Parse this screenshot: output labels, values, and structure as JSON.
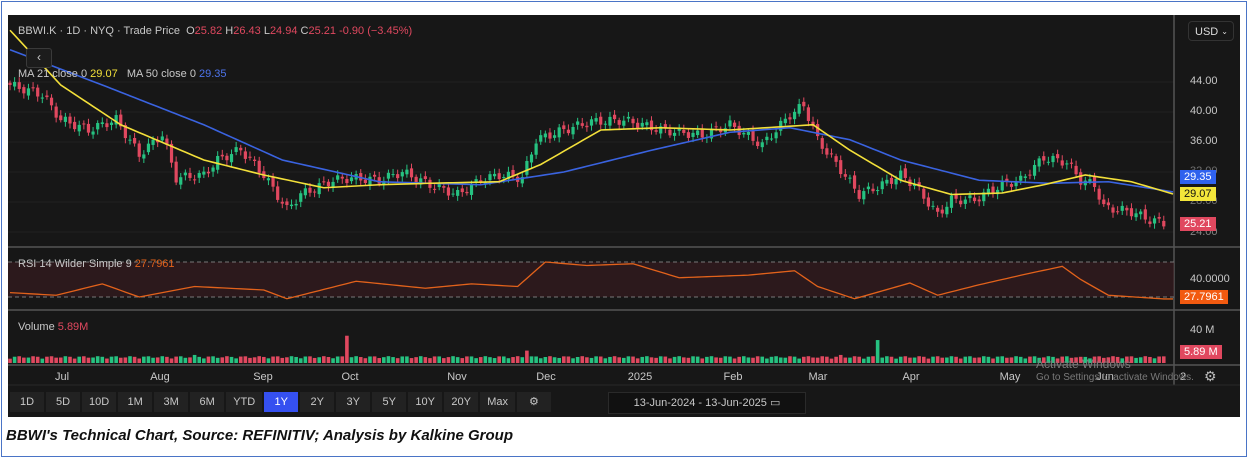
{
  "header": {
    "symbol": "BBWI.K · 1D · NYQ · Trade Price",
    "o_label": "O",
    "o": "25.82",
    "h_label": "H",
    "h": "26.43",
    "l_label": "L",
    "l": "24.94",
    "c_label": "C",
    "c": "25.21",
    "change": "-0.90 (−3.45%)",
    "collapse_icon": "‹"
  },
  "ma": {
    "ma21_label": "MA 21 close 0",
    "ma21": "29.07",
    "ma50_label": "MA 50 close 0",
    "ma50": "29.35"
  },
  "rsi": {
    "label": "RSI 14 Wilder Simple 9",
    "value": "27.7961",
    "level": "40.0000"
  },
  "volume": {
    "label": "Volume",
    "value": "5.89 M",
    "value_short": "5.89M",
    "tick": "40 M"
  },
  "currency": "USD",
  "price_ticks": [
    "44.00",
    "40.00",
    "36.00",
    "32.00",
    "28.00",
    "24.00"
  ],
  "x_labels": [
    "Jul",
    "Aug",
    "Sep",
    "Oct",
    "Nov",
    "Dec",
    "2025",
    "Feb",
    "Mar",
    "Apr",
    "May",
    "Jun",
    "2"
  ],
  "ranges": [
    "1D",
    "5D",
    "10D",
    "1M",
    "3M",
    "6M",
    "YTD",
    "1Y",
    "2Y",
    "3Y",
    "5Y",
    "10Y",
    "20Y",
    "Max"
  ],
  "active_range": "1Y",
  "date_range": "13-Jun-2024  -  13-Jun-2025",
  "watermark": {
    "title": "Activate Windows",
    "sub": "Go to Settings to activate Windows."
  },
  "caption": "BBWI's Technical Chart, Source: REFINITIV; Analysis by Kalkine Group",
  "colors": {
    "up": "#26c281",
    "down": "#e0485f",
    "ma21": "#f3e03a",
    "ma50": "#3a63e0",
    "rsi": "#e2621b",
    "active": "#3550f0"
  },
  "chart_data": {
    "type": "line",
    "title": "BBWI.K 1D Trade Price",
    "days_total": 252,
    "close": [
      [
        0,
        43.6
      ],
      [
        7,
        42.3
      ],
      [
        11,
        39
      ],
      [
        17,
        37.6
      ],
      [
        23,
        39
      ],
      [
        28,
        34.3
      ],
      [
        33,
        37
      ],
      [
        36,
        31.2
      ],
      [
        42,
        31.6
      ],
      [
        45,
        33.6
      ],
      [
        50,
        35
      ],
      [
        55,
        31.6
      ],
      [
        60,
        27
      ],
      [
        63,
        29
      ],
      [
        70,
        30.9
      ],
      [
        74,
        31.2
      ],
      [
        80,
        30.9
      ],
      [
        85,
        32
      ],
      [
        91,
        30.3
      ],
      [
        97,
        29
      ],
      [
        102,
        30.9
      ],
      [
        106,
        31.6
      ],
      [
        111,
        31.2
      ],
      [
        114,
        36.3
      ],
      [
        120,
        37.6
      ],
      [
        126,
        38.7
      ],
      [
        133,
        38.9
      ],
      [
        137,
        38.3
      ],
      [
        141,
        37.6
      ],
      [
        150,
        36.9
      ],
      [
        156,
        38.3
      ],
      [
        163,
        35.6
      ],
      [
        169,
        39.6
      ],
      [
        172,
        40.9
      ],
      [
        175,
        36.3
      ],
      [
        180,
        32.3
      ],
      [
        184,
        29
      ],
      [
        189,
        30.3
      ],
      [
        193,
        31.6
      ],
      [
        196,
        30.3
      ],
      [
        201,
        26.3
      ],
      [
        204,
        28.3
      ],
      [
        209,
        28.3
      ],
      [
        215,
        30.3
      ],
      [
        219,
        30.9
      ],
      [
        224,
        33.9
      ],
      [
        229,
        33.3
      ],
      [
        232,
        30.9
      ],
      [
        235,
        30.3
      ],
      [
        237,
        27.3
      ],
      [
        243,
        26.7
      ],
      [
        247,
        25.6
      ],
      [
        250,
        25.21
      ]
    ],
    "ma21": [
      [
        0,
        50.9
      ],
      [
        11,
        43.6
      ],
      [
        24,
        38.3
      ],
      [
        42,
        33.6
      ],
      [
        55,
        31.6
      ],
      [
        68,
        29.9
      ],
      [
        80,
        30.3
      ],
      [
        91,
        30.5
      ],
      [
        106,
        30.7
      ],
      [
        115,
        33
      ],
      [
        128,
        37.6
      ],
      [
        141,
        37.9
      ],
      [
        156,
        37.6
      ],
      [
        174,
        38.3
      ],
      [
        182,
        34.9
      ],
      [
        193,
        30.9
      ],
      [
        204,
        29
      ],
      [
        215,
        29.2
      ],
      [
        224,
        30.3
      ],
      [
        233,
        31.6
      ],
      [
        243,
        30.7
      ],
      [
        252,
        29.07
      ]
    ],
    "ma50": [
      [
        0,
        48.3
      ],
      [
        20,
        43.6
      ],
      [
        42,
        38.3
      ],
      [
        59,
        33.6
      ],
      [
        80,
        30.7
      ],
      [
        102,
        30.3
      ],
      [
        120,
        32
      ],
      [
        139,
        34.9
      ],
      [
        156,
        37.3
      ],
      [
        169,
        37.9
      ],
      [
        182,
        36.3
      ],
      [
        193,
        33.6
      ],
      [
        210,
        30.9
      ],
      [
        225,
        30.5
      ],
      [
        238,
        30.7
      ],
      [
        252,
        29.35
      ]
    ],
    "rsi": [
      [
        0,
        35
      ],
      [
        10,
        32
      ],
      [
        20,
        45
      ],
      [
        28,
        30
      ],
      [
        40,
        42
      ],
      [
        55,
        38
      ],
      [
        60,
        28
      ],
      [
        75,
        48
      ],
      [
        90,
        40
      ],
      [
        100,
        45
      ],
      [
        110,
        42
      ],
      [
        116,
        70
      ],
      [
        125,
        66
      ],
      [
        135,
        68
      ],
      [
        145,
        52
      ],
      [
        160,
        55
      ],
      [
        170,
        60
      ],
      [
        175,
        42
      ],
      [
        183,
        28
      ],
      [
        195,
        46
      ],
      [
        201,
        32
      ],
      [
        210,
        44
      ],
      [
        220,
        56
      ],
      [
        228,
        65
      ],
      [
        232,
        50
      ],
      [
        238,
        32
      ],
      [
        250,
        27.8
      ]
    ],
    "rsi_bands": [
      70,
      30
    ],
    "volume_base_m": 7,
    "volume_spikes": [
      [
        73,
        44,
        "down"
      ],
      [
        112,
        20,
        "down"
      ],
      [
        188,
        37,
        "up"
      ],
      [
        40,
        13,
        "up"
      ],
      [
        180,
        13,
        "down"
      ],
      [
        232,
        10,
        "down"
      ]
    ],
    "volume_last_m": 5.89,
    "ylim": [
      22,
      47
    ]
  }
}
